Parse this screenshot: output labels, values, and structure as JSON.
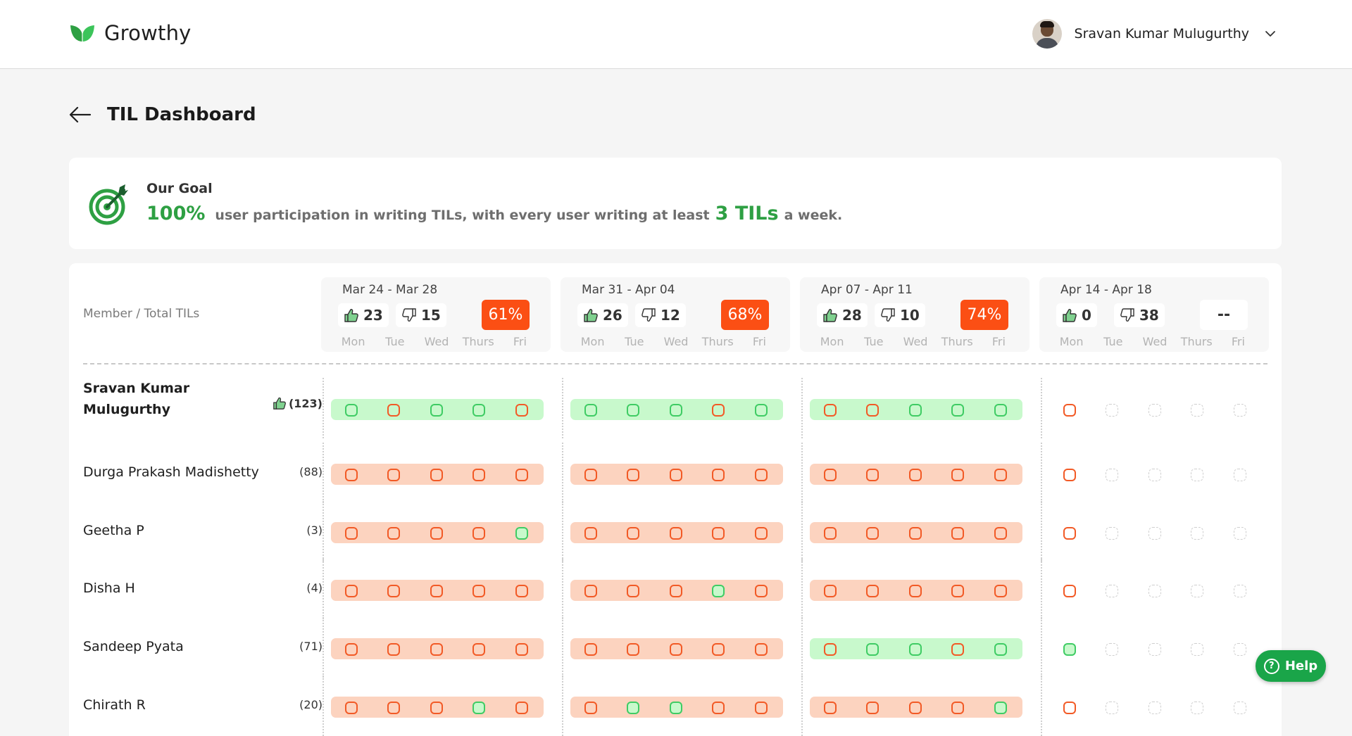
{
  "app": {
    "name": "Growthy",
    "brand_color": "#2ea043",
    "user_name": "Sravan Kumar Mulugurthy"
  },
  "page": {
    "title": "TIL Dashboard"
  },
  "goal": {
    "label": "Our Goal",
    "percent": "100%",
    "text_before": "user participation in writing TILs, with every user writing at least",
    "tils": "3 TILs",
    "text_after": "a week."
  },
  "board": {
    "member_column_header": "Member / Total TILs",
    "day_labels": [
      "Mon",
      "Tue",
      "Wed",
      "Thurs",
      "Fri"
    ],
    "weeks": [
      {
        "range": "Mar 24 - Mar 28",
        "up": "23",
        "down": "15",
        "percent": "61%"
      },
      {
        "range": "Mar 31 - Apr 04",
        "up": "26",
        "down": "12",
        "percent": "68%"
      },
      {
        "range": "Apr 07 - Apr 11",
        "up": "28",
        "down": "10",
        "percent": "74%"
      },
      {
        "range": "Apr 14 - Apr 18",
        "up": "0",
        "down": "38",
        "percent": "--"
      }
    ],
    "members": [
      {
        "name": "Sravan Kumar Mulugurthy",
        "total": "(123)",
        "is_current_user": true,
        "weeks": [
          {
            "status": "green",
            "days": [
              "done",
              "missed",
              "done",
              "done",
              "missed"
            ]
          },
          {
            "status": "green",
            "days": [
              "done",
              "done",
              "done",
              "missed",
              "done"
            ]
          },
          {
            "status": "green",
            "days": [
              "missed",
              "missed",
              "done",
              "done",
              "done"
            ]
          },
          {
            "status": "none",
            "days": [
              "missed",
              "empty",
              "empty",
              "empty",
              "empty"
            ]
          }
        ]
      },
      {
        "name": "Durga Prakash Madishetty",
        "total": "(88)",
        "weeks": [
          {
            "status": "red",
            "days": [
              "missed",
              "missed",
              "missed",
              "missed",
              "missed"
            ]
          },
          {
            "status": "red",
            "days": [
              "missed",
              "missed",
              "missed",
              "missed",
              "missed"
            ]
          },
          {
            "status": "red",
            "days": [
              "missed",
              "missed",
              "missed",
              "missed",
              "missed"
            ]
          },
          {
            "status": "none",
            "days": [
              "missed",
              "empty",
              "empty",
              "empty",
              "empty"
            ]
          }
        ]
      },
      {
        "name": "Geetha P",
        "total": "(3)",
        "weeks": [
          {
            "status": "red",
            "days": [
              "missed",
              "missed",
              "missed",
              "missed",
              "done-filled"
            ]
          },
          {
            "status": "red",
            "days": [
              "missed",
              "missed",
              "missed",
              "missed",
              "missed"
            ]
          },
          {
            "status": "red",
            "days": [
              "missed",
              "missed",
              "missed",
              "missed",
              "missed"
            ]
          },
          {
            "status": "none",
            "days": [
              "missed",
              "empty",
              "empty",
              "empty",
              "empty"
            ]
          }
        ]
      },
      {
        "name": "Disha H",
        "total": "(4)",
        "weeks": [
          {
            "status": "red",
            "days": [
              "missed",
              "missed",
              "missed",
              "missed",
              "missed"
            ]
          },
          {
            "status": "red",
            "days": [
              "missed",
              "missed",
              "missed",
              "done-filled",
              "missed"
            ]
          },
          {
            "status": "red",
            "days": [
              "missed",
              "missed",
              "missed",
              "missed",
              "missed"
            ]
          },
          {
            "status": "none",
            "days": [
              "missed",
              "empty",
              "empty",
              "empty",
              "empty"
            ]
          }
        ]
      },
      {
        "name": "Sandeep Pyata",
        "total": "(71)",
        "weeks": [
          {
            "status": "red",
            "days": [
              "missed",
              "missed",
              "missed",
              "missed",
              "missed"
            ]
          },
          {
            "status": "red",
            "days": [
              "missed",
              "missed",
              "missed",
              "missed",
              "missed"
            ]
          },
          {
            "status": "green",
            "days": [
              "missed",
              "done",
              "done",
              "missed",
              "done"
            ]
          },
          {
            "status": "none",
            "days": [
              "done-filled",
              "empty",
              "empty",
              "empty",
              "empty"
            ]
          }
        ]
      },
      {
        "name": "Chirath R",
        "total": "(20)",
        "weeks": [
          {
            "status": "red",
            "days": [
              "missed",
              "missed",
              "missed",
              "done-filled",
              "missed"
            ]
          },
          {
            "status": "red",
            "days": [
              "missed",
              "done-filled",
              "done-filled",
              "missed",
              "missed"
            ]
          },
          {
            "status": "red",
            "days": [
              "missed",
              "missed",
              "missed",
              "missed",
              "done-filled"
            ]
          },
          {
            "status": "none",
            "days": [
              "missed",
              "empty",
              "empty",
              "empty",
              "empty"
            ]
          }
        ]
      }
    ]
  },
  "help": {
    "label": "Help"
  },
  "icons": {
    "logo": "leaf-logo-icon",
    "target": "target-goal-icon",
    "thumbs_up": "thumbs-up-icon",
    "thumbs_down": "thumbs-down-icon",
    "back": "arrow-left-icon",
    "chevron": "chevron-down-icon",
    "help": "question-circle-icon"
  },
  "colors": {
    "accent_orange": "#fb4f14",
    "missed_border": "#f25a26",
    "done_border": "#3fcc64",
    "red_strip": "#fcd3bf",
    "green_strip": "#c8f9cc",
    "help_green": "#1aa549"
  }
}
